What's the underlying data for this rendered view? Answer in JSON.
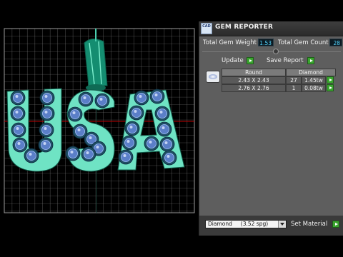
{
  "panel": {
    "title": "GEM REPORTER",
    "logo_text": "CAD",
    "total_weight_label": "Total Gem Weight",
    "total_weight_value": "1.53",
    "total_count_label": "Total Gem Count",
    "total_count_value": "28",
    "update_label": "Update",
    "save_report_label": "Save Report",
    "report": {
      "columns": [
        "Round",
        "Diamond"
      ],
      "rows": [
        {
          "size": "2.43 X 2.43",
          "count": "27",
          "weight": "1.45tw"
        },
        {
          "size": "2.76 X 2.76",
          "count": "1",
          "weight": "0.08tw"
        }
      ]
    },
    "material_select": "Diamond     (3.52 spg)",
    "set_material_label": "Set Material"
  },
  "viewport": {
    "letters": "USA",
    "colors": {
      "background": "#000000",
      "grid": "#8a8a8a",
      "metal": "#6fe3c4",
      "gem_ring": "#1f4e66",
      "gem": "#5b7fc8",
      "axis_red": "#c00000",
      "bail": "#1a9e80"
    }
  },
  "icons": {
    "logo": "gem-reporter-logo-icon",
    "arrow": "play-arrow-icon",
    "gem": "round-gem-icon"
  }
}
